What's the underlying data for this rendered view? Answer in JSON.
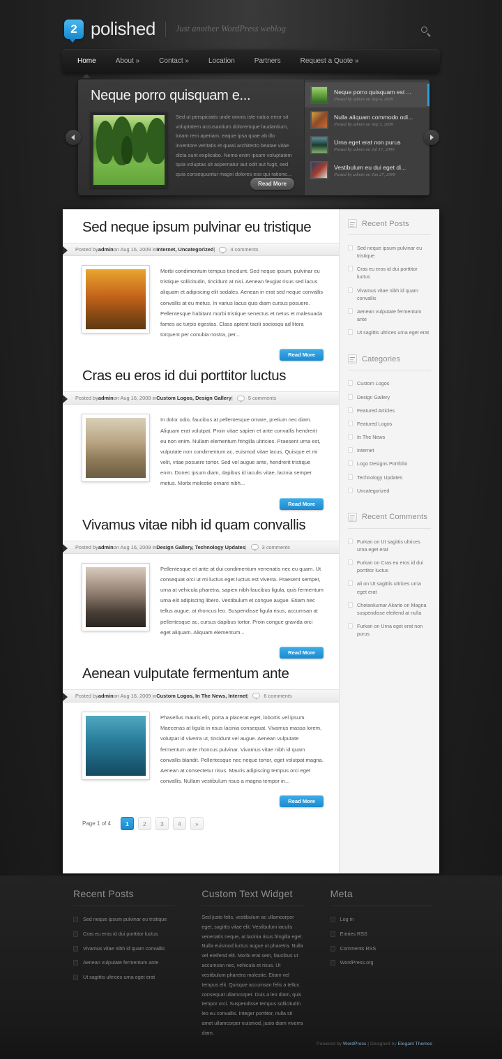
{
  "site": {
    "logo_number": "2",
    "logo_text": "polished",
    "tagline": "Just another WordPress weblog"
  },
  "nav": {
    "items": [
      {
        "label": "Home",
        "active": true
      },
      {
        "label": "About »",
        "active": false
      },
      {
        "label": "Contact »",
        "active": false
      },
      {
        "label": "Location",
        "active": false
      },
      {
        "label": "Partners",
        "active": false
      },
      {
        "label": "Request a Quote »",
        "active": false
      }
    ]
  },
  "slider": {
    "title": "Neque porro quisquam e...",
    "excerpt": "Sed ut perspiciatis unde omnis iste natus error sit voluptatem accusantium doloremque laudantium, totam rem aperiam, eaque ipsa quae ab illo inventore veritatis et quasi architecto beatae vitae dicta sunt explicabo. Nemo enim ipsam voluptatem quia voluptas sit aspernatur aut odit aut fugit, sed quia consequuntur magni dolores eos qui ratione...",
    "read_more": "Read More",
    "prev_label": "‹",
    "next_label": "›",
    "entries": [
      {
        "title": "Neque porro quisquam est ...",
        "meta": "Posted by admin on Sep 4, 2009",
        "active": true
      },
      {
        "title": "Nulla aliquam commodo odi...",
        "meta": "Posted by admin on Sep 3, 2009",
        "active": false
      },
      {
        "title": "Urna eget erat non purus",
        "meta": "Posted by admin on Jul 17, 2009",
        "active": false
      },
      {
        "title": "Vestibulum eu dui eget di...",
        "meta": "Posted by admin on Jan 27, 2009",
        "active": false
      }
    ]
  },
  "posts": [
    {
      "title": "Sed neque ipsum pulvinar eu tristique",
      "meta_prefix": "Posted by ",
      "author": "admin",
      "meta_on": " on Aug 16, 2009 in ",
      "categories": "Internet, Uncategorized",
      "meta_sep": " | ",
      "comments": "4 comments",
      "excerpt": "Morbi condimentum tempus tincidunt. Sed neque ipsum, pulvinar eu tristique sollicitudin, tincidunt at nisi. Aenean feugiat risus sed lacus aliquam et adipiscing elit sodales. Aenean in erat sed neque convallis convallis at eu metus. In varius lacus quis diam cursus posuere. Pellentesque habitant morbi tristique senectus et netus et malesuada fames ac turpis egestas. Class aptent taciti sociosqu ad litora torquent per conubia nostra, per...",
      "read_more": "Read More"
    },
    {
      "title": "Cras eu eros id dui porttitor luctus",
      "meta_prefix": "Posted by ",
      "author": "admin",
      "meta_on": " on Aug 16, 2009 in ",
      "categories": "Custom Logos, Design Gallery",
      "meta_sep": " | ",
      "comments": "5 comments",
      "excerpt": "In dolor odio, faucibus at pellentesque ornare, pretium nec diam. Aliquam erat volutpat. Proin vitae sapien et ante convallis hendrerit eu non enim. Nullam elementum fringilla ultricies. Praesent urna est, vulputate non condimentum ac, euismod vitae lacus. Quisque et mi velit, vitae posuere tortor. Sed vel augue ante, hendrerit tristique enim. Donec ipsum diam, dapibus id iaculis vitae, lacinia semper metus. Morbi molestie ornare nibh...",
      "read_more": "Read More"
    },
    {
      "title": "Vivamus vitae nibh id quam convallis",
      "meta_prefix": "Posted by ",
      "author": "admin",
      "meta_on": " on Aug 16, 2009 in ",
      "categories": "Design Gallery, Technology Updates",
      "meta_sep": " | ",
      "comments": "3 comments",
      "excerpt": "Pellentesque et ante at dui condimentum venenatis nec eu quam. Ut consequat orci ut mi luctus eget luctus est viverra. Praesent semper, urna at vehicula pharetra, sapien nibh faucibus ligula, quis fermentum urna elit adipiscing libero. Vestibulum et congue augue. Etiam nec tellus augue, at rhoncus leo. Suspendisse ligula risus, accumsan at pellentesque ac, cursus dapibus tortor. Proin congue gravida orci eget aliquam. Aliquam elementum...",
      "read_more": "Read More"
    },
    {
      "title": "Aenean vulputate fermentum ante",
      "meta_prefix": "Posted by ",
      "author": "admin",
      "meta_on": " on Aug 16, 2009 in ",
      "categories": "Custom Logos, In The News, Internet",
      "meta_sep": " | ",
      "comments": "6 comments",
      "excerpt": "Phasellus mauris elit, porta a placerat eget, lobortis vel ipsum. Maecenas at ligula in risus lacinia consequat. Vivamus massa lorem, volutpat id viverra ut, tincidunt vel augue. Aenean vulputate fermentum ante rhoncus pulvinar. Vivamus vitae nibh id quam convallis blandit. Pellentesque nec neque tortor, eget volutpat magna. Aenean at consectetur risus. Mauris adipiscing tempus orci eget convallis. Nullam vestibulum risus a magna tempor in...",
      "read_more": "Read More"
    }
  ],
  "pagination": {
    "label": "Page 1 of 4",
    "pages": [
      "1",
      "2",
      "3",
      "4",
      "»"
    ],
    "current": "1"
  },
  "sidebar": {
    "widgets": [
      {
        "title": "Recent Posts",
        "items": [
          "Sed neque ipsum pulvinar eu tristique",
          "Cras eu eros id dui porttitor luctus",
          "Vivamus vitae nibh id quam convallis",
          "Aenean vulputate fermentum ante",
          "Ut sagittis ultrices urna eget erat"
        ]
      },
      {
        "title": "Categories",
        "items": [
          "Custom Logos",
          "Design Gallery",
          "Featured Articles",
          "Featured Logos",
          "In The News",
          "Internet",
          "Logo Designs Portfolio",
          "Technology Updates",
          "Uncategorized"
        ]
      },
      {
        "title": "Recent Comments",
        "items": [
          "Furkan on Ut sagittis ultrices urna eget erat",
          "Furkan on Cras eu eros id dui porttitor luctus",
          "ali on Ut sagittis ultrices urna eget erat",
          "Chetankumar Akarte on Magna suspendisse eleifend at nulla",
          "Furkan on Urna eget erat non purus"
        ]
      }
    ]
  },
  "footer": {
    "recent_posts": {
      "title": "Recent Posts",
      "items": [
        "Sed neque ipsum pulvinar eu tristique",
        "Cras eu eros id dui porttitor luctus",
        "Vivamus vitae nibh id quam convallis",
        "Aenean vulputate fermentum ante",
        "Ut sagittis ultrices urna eget erat"
      ]
    },
    "custom_text": {
      "title": "Custom Text Widget",
      "body": "Sed justo felis, vestibulum ac ullamcorper eget, sagittis vitae elit. Vestibulum iaculis venenatis neque, at lacinia risus fringilla eget. Nulla euismod luctus augue ut pharetra. Nulla vel eleifend elit. Morbi erat sem, faucibus ut accumsan nec, vehicula et risus. Ut vestibulum pharetra molestie. Etiam vel tempus elit. Quisque accumsan felis a tellus consequat ullamcorper. Duis a leo diam, quis tempor orci. Suspendisse tempus sollicitudin leo eu convallis. Integer porttitor, nulla sit amet ullamcorper euismod, justo diam viverra diam."
    },
    "meta": {
      "title": "Meta",
      "items": [
        "Log in",
        "Entries RSS",
        "Comments RSS",
        "WordPress.org"
      ]
    },
    "credit_prefix": "Powered by ",
    "credit_wordpress": "WordPress",
    "credit_mid": " | Designed by ",
    "credit_designer": "Elegant Themes"
  },
  "colors": {
    "accent_blue": "#1b8ad0",
    "logo_blue": "#1789cf",
    "page_bg": "#1c1c1c",
    "content_bg": "#ffffff",
    "sidebar_bg": "#f4f4f4"
  }
}
